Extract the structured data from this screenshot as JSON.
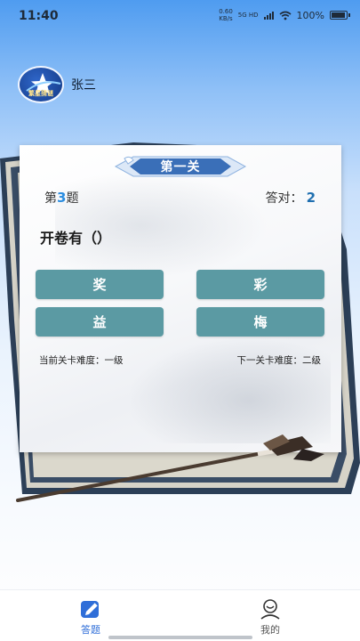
{
  "status": {
    "time": "11:40",
    "net_speed": "0.60",
    "net_unit": "KB/s",
    "net_type_top": "5G HD",
    "net_type_bottom": "",
    "battery": "100%",
    "battery_level": 1.0
  },
  "user": {
    "name": "张三",
    "avatar_logo_text": "繁星猜谜"
  },
  "quiz": {
    "level_title": "第一关",
    "question_prefix": "第",
    "question_number": "3",
    "question_suffix": "题",
    "correct_label": "答对：",
    "correct_count": "2",
    "question_text": "开卷有（）",
    "options": [
      "奖",
      "彩",
      "益",
      "梅"
    ],
    "current_difficulty": "当前关卡难度：一级",
    "next_difficulty": "下一关卡难度：二级"
  },
  "nav": {
    "items": [
      {
        "label": "答题",
        "icon": "quiz-icon",
        "active": true
      },
      {
        "label": "我的",
        "icon": "profile-icon",
        "active": false
      }
    ]
  },
  "colors": {
    "accent": "#2f6ed8",
    "option_bg": "#5b9aa3",
    "banner": "#3a6fb8"
  }
}
